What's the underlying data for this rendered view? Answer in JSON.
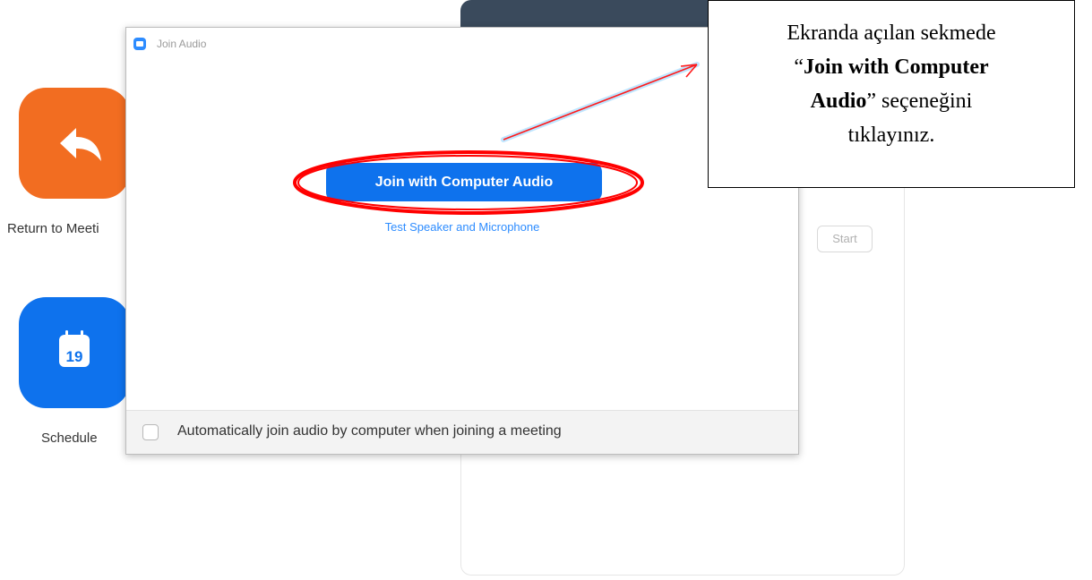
{
  "background": {
    "tiles": [
      {
        "label": "Return to Meeti",
        "icon": "return-arrow-icon",
        "color": "#f26d21"
      },
      {
        "label": "Schedule",
        "icon": "calendar-icon",
        "color": "#0e72ed",
        "calendar_day": "19"
      }
    ],
    "start_button": "Start"
  },
  "dialog": {
    "title": "Join Audio",
    "join_button": "Join with Computer Audio",
    "test_link": "Test Speaker and Microphone",
    "auto_join_checkbox_label": "Automatically join audio by computer when joining a meeting",
    "auto_join_checked": false
  },
  "annotation": {
    "line1": "Ekranda açılan sekmede",
    "quote_open": "“",
    "bold1": "Join with Computer",
    "bold2": "Audio",
    "quote_close_rest": "” seçeneğini",
    "line4": "tıklayınız.",
    "highlight_color": "#ff0000"
  },
  "colors": {
    "zoom_blue": "#0e72ed",
    "link_blue": "#2d8cff"
  }
}
